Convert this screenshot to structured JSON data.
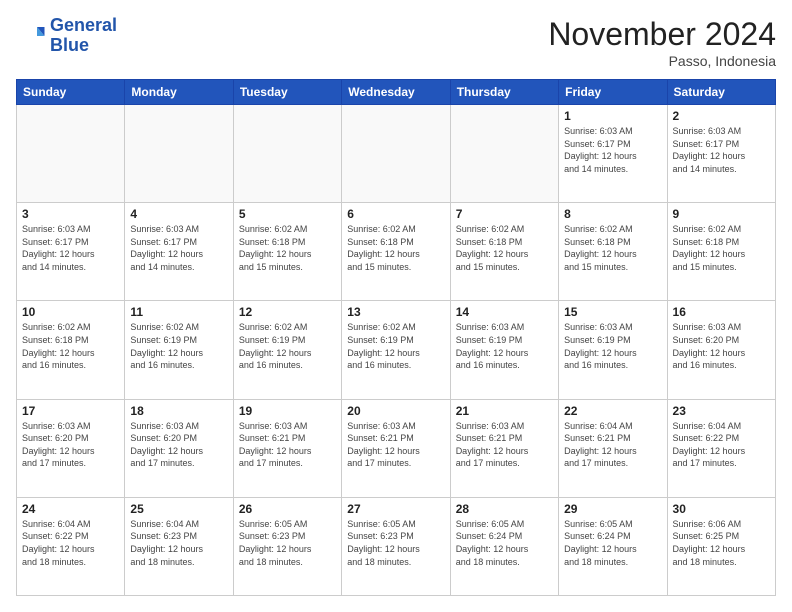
{
  "header": {
    "logo_line1": "General",
    "logo_line2": "Blue",
    "month": "November 2024",
    "location": "Passo, Indonesia"
  },
  "weekdays": [
    "Sunday",
    "Monday",
    "Tuesday",
    "Wednesday",
    "Thursday",
    "Friday",
    "Saturday"
  ],
  "weeks": [
    [
      {
        "day": "",
        "info": ""
      },
      {
        "day": "",
        "info": ""
      },
      {
        "day": "",
        "info": ""
      },
      {
        "day": "",
        "info": ""
      },
      {
        "day": "",
        "info": ""
      },
      {
        "day": "1",
        "info": "Sunrise: 6:03 AM\nSunset: 6:17 PM\nDaylight: 12 hours\nand 14 minutes."
      },
      {
        "day": "2",
        "info": "Sunrise: 6:03 AM\nSunset: 6:17 PM\nDaylight: 12 hours\nand 14 minutes."
      }
    ],
    [
      {
        "day": "3",
        "info": "Sunrise: 6:03 AM\nSunset: 6:17 PM\nDaylight: 12 hours\nand 14 minutes."
      },
      {
        "day": "4",
        "info": "Sunrise: 6:03 AM\nSunset: 6:17 PM\nDaylight: 12 hours\nand 14 minutes."
      },
      {
        "day": "5",
        "info": "Sunrise: 6:02 AM\nSunset: 6:18 PM\nDaylight: 12 hours\nand 15 minutes."
      },
      {
        "day": "6",
        "info": "Sunrise: 6:02 AM\nSunset: 6:18 PM\nDaylight: 12 hours\nand 15 minutes."
      },
      {
        "day": "7",
        "info": "Sunrise: 6:02 AM\nSunset: 6:18 PM\nDaylight: 12 hours\nand 15 minutes."
      },
      {
        "day": "8",
        "info": "Sunrise: 6:02 AM\nSunset: 6:18 PM\nDaylight: 12 hours\nand 15 minutes."
      },
      {
        "day": "9",
        "info": "Sunrise: 6:02 AM\nSunset: 6:18 PM\nDaylight: 12 hours\nand 15 minutes."
      }
    ],
    [
      {
        "day": "10",
        "info": "Sunrise: 6:02 AM\nSunset: 6:18 PM\nDaylight: 12 hours\nand 16 minutes."
      },
      {
        "day": "11",
        "info": "Sunrise: 6:02 AM\nSunset: 6:19 PM\nDaylight: 12 hours\nand 16 minutes."
      },
      {
        "day": "12",
        "info": "Sunrise: 6:02 AM\nSunset: 6:19 PM\nDaylight: 12 hours\nand 16 minutes."
      },
      {
        "day": "13",
        "info": "Sunrise: 6:02 AM\nSunset: 6:19 PM\nDaylight: 12 hours\nand 16 minutes."
      },
      {
        "day": "14",
        "info": "Sunrise: 6:03 AM\nSunset: 6:19 PM\nDaylight: 12 hours\nand 16 minutes."
      },
      {
        "day": "15",
        "info": "Sunrise: 6:03 AM\nSunset: 6:19 PM\nDaylight: 12 hours\nand 16 minutes."
      },
      {
        "day": "16",
        "info": "Sunrise: 6:03 AM\nSunset: 6:20 PM\nDaylight: 12 hours\nand 16 minutes."
      }
    ],
    [
      {
        "day": "17",
        "info": "Sunrise: 6:03 AM\nSunset: 6:20 PM\nDaylight: 12 hours\nand 17 minutes."
      },
      {
        "day": "18",
        "info": "Sunrise: 6:03 AM\nSunset: 6:20 PM\nDaylight: 12 hours\nand 17 minutes."
      },
      {
        "day": "19",
        "info": "Sunrise: 6:03 AM\nSunset: 6:21 PM\nDaylight: 12 hours\nand 17 minutes."
      },
      {
        "day": "20",
        "info": "Sunrise: 6:03 AM\nSunset: 6:21 PM\nDaylight: 12 hours\nand 17 minutes."
      },
      {
        "day": "21",
        "info": "Sunrise: 6:03 AM\nSunset: 6:21 PM\nDaylight: 12 hours\nand 17 minutes."
      },
      {
        "day": "22",
        "info": "Sunrise: 6:04 AM\nSunset: 6:21 PM\nDaylight: 12 hours\nand 17 minutes."
      },
      {
        "day": "23",
        "info": "Sunrise: 6:04 AM\nSunset: 6:22 PM\nDaylight: 12 hours\nand 17 minutes."
      }
    ],
    [
      {
        "day": "24",
        "info": "Sunrise: 6:04 AM\nSunset: 6:22 PM\nDaylight: 12 hours\nand 18 minutes."
      },
      {
        "day": "25",
        "info": "Sunrise: 6:04 AM\nSunset: 6:23 PM\nDaylight: 12 hours\nand 18 minutes."
      },
      {
        "day": "26",
        "info": "Sunrise: 6:05 AM\nSunset: 6:23 PM\nDaylight: 12 hours\nand 18 minutes."
      },
      {
        "day": "27",
        "info": "Sunrise: 6:05 AM\nSunset: 6:23 PM\nDaylight: 12 hours\nand 18 minutes."
      },
      {
        "day": "28",
        "info": "Sunrise: 6:05 AM\nSunset: 6:24 PM\nDaylight: 12 hours\nand 18 minutes."
      },
      {
        "day": "29",
        "info": "Sunrise: 6:05 AM\nSunset: 6:24 PM\nDaylight: 12 hours\nand 18 minutes."
      },
      {
        "day": "30",
        "info": "Sunrise: 6:06 AM\nSunset: 6:25 PM\nDaylight: 12 hours\nand 18 minutes."
      }
    ]
  ]
}
